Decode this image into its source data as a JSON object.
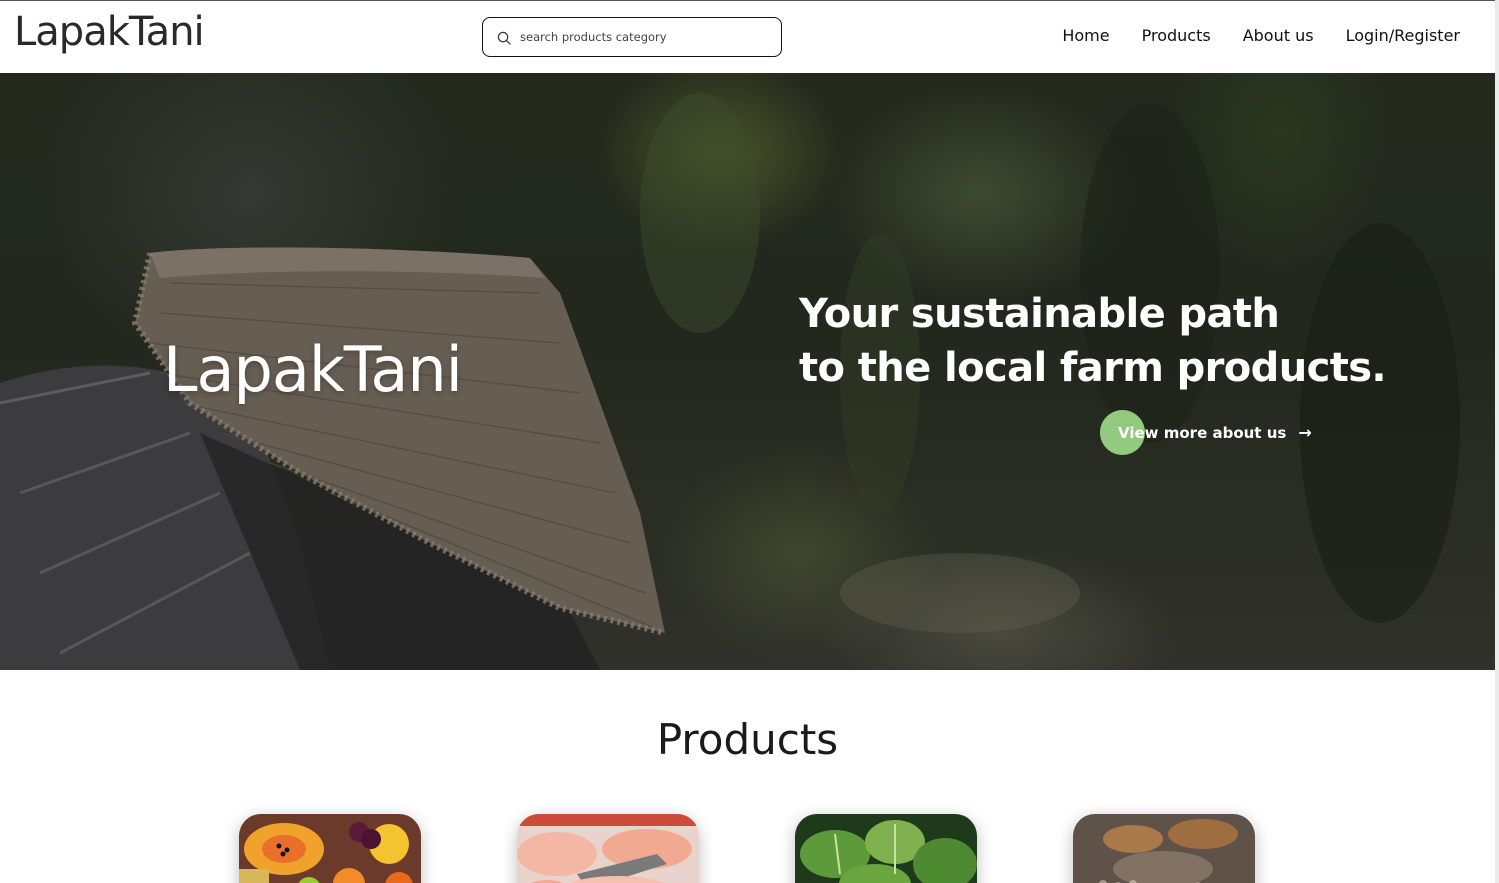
{
  "header": {
    "brand": "LapakTani",
    "search": {
      "placeholder": "search products category",
      "icon": "search-icon"
    },
    "nav": [
      {
        "label": "Home"
      },
      {
        "label": "Products"
      },
      {
        "label": "About us"
      },
      {
        "label": "Login/Register"
      }
    ]
  },
  "hero": {
    "brand": "LapakTani",
    "tagline_line1": "Your sustainable path",
    "tagline_line2": "to the local farm products.",
    "cta_label": "View more about us",
    "cta_icon": "arrow-right-icon",
    "accent_color": "#9fdb8a"
  },
  "products": {
    "title": "Products",
    "cards": [
      {
        "image": "fruits-image"
      },
      {
        "image": "chicken-meat-image"
      },
      {
        "image": "leafy-greens-image"
      },
      {
        "image": "market-goods-image"
      }
    ]
  }
}
